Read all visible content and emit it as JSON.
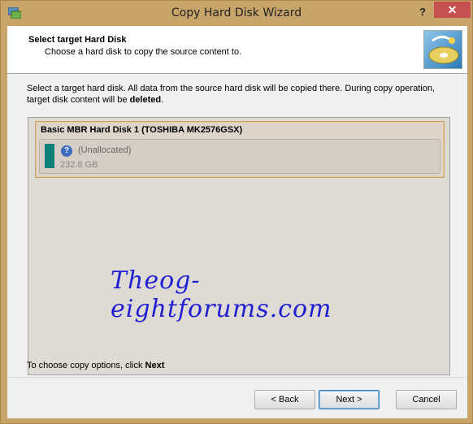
{
  "window": {
    "title": "Copy Hard Disk Wizard",
    "help_label": "?",
    "close_label": "✕"
  },
  "header": {
    "title": "Select target Hard Disk",
    "subtitle": "Choose a hard disk to copy the source content to."
  },
  "description": {
    "line_start": "Select a target hard disk. All data from the source hard disk will be copied there. During copy operation, target disk content will be ",
    "emphasis": "deleted",
    "line_end": "."
  },
  "disk": {
    "name": "Basic MBR Hard Disk 1 (TOSHIBA MK2576GSX)",
    "partition_label": "(Unallocated)",
    "partition_size": "232.8 GB",
    "partition_color": "#0e8078"
  },
  "watermark": "Theog-eightforums.com",
  "hint": {
    "text": "To choose copy options, click ",
    "emphasis": "Next"
  },
  "buttons": {
    "back": "< Back",
    "next": "Next >",
    "cancel": "Cancel"
  }
}
